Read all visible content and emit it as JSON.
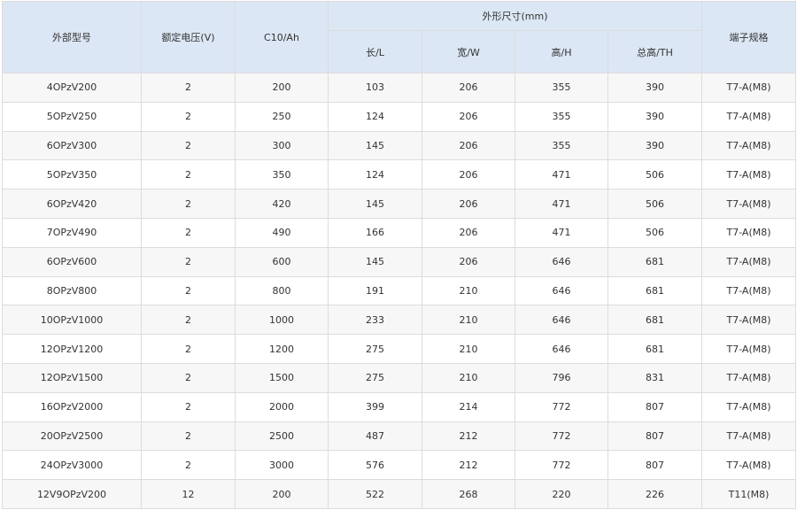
{
  "headers": {
    "model": "外部型号",
    "voltage": "额定电压(V)",
    "capacity": "C10/Ah",
    "dimensions": "外形尺寸(mm)",
    "length": "长/L",
    "width": "宽/W",
    "height": "高/H",
    "total_height": "总高/TH",
    "terminal": "端子规格"
  },
  "rows": [
    [
      "4OPzV200",
      "2",
      "200",
      "103",
      "206",
      "355",
      "390",
      "T7-A(M8)"
    ],
    [
      "5OPzV250",
      "2",
      "250",
      "124",
      "206",
      "355",
      "390",
      "T7-A(M8)"
    ],
    [
      "6OPzV300",
      "2",
      "300",
      "145",
      "206",
      "355",
      "390",
      "T7-A(M8)"
    ],
    [
      "5OPzV350",
      "2",
      "350",
      "124",
      "206",
      "471",
      "506",
      "T7-A(M8)"
    ],
    [
      "6OPzV420",
      "2",
      "420",
      "145",
      "206",
      "471",
      "506",
      "T7-A(M8)"
    ],
    [
      "7OPzV490",
      "2",
      "490",
      "166",
      "206",
      "471",
      "506",
      "T7-A(M8)"
    ],
    [
      "6OPzV600",
      "2",
      "600",
      "145",
      "206",
      "646",
      "681",
      "T7-A(M8)"
    ],
    [
      "8OPzV800",
      "2",
      "800",
      "191",
      "210",
      "646",
      "681",
      "T7-A(M8)"
    ],
    [
      "10OPzV1000",
      "2",
      "1000",
      "233",
      "210",
      "646",
      "681",
      "T7-A(M8)"
    ],
    [
      "12OPzV1200",
      "2",
      "1200",
      "275",
      "210",
      "646",
      "681",
      "T7-A(M8)"
    ],
    [
      "12OPzV1500",
      "2",
      "1500",
      "275",
      "210",
      "796",
      "831",
      "T7-A(M8)"
    ],
    [
      "16OPzV2000",
      "2",
      "2000",
      "399",
      "214",
      "772",
      "807",
      "T7-A(M8)"
    ],
    [
      "20OPzV2500",
      "2",
      "2500",
      "487",
      "212",
      "772",
      "807",
      "T7-A(M8)"
    ],
    [
      "24OPzV3000",
      "2",
      "3000",
      "576",
      "212",
      "772",
      "807",
      "T7-A(M8)"
    ],
    [
      "12V9OPzV200",
      "12",
      "200",
      "522",
      "268",
      "220",
      "226",
      "T11(M8)"
    ]
  ]
}
